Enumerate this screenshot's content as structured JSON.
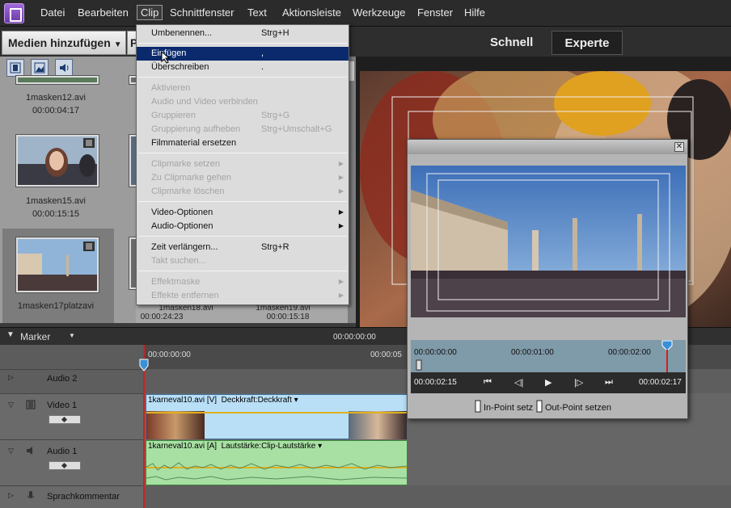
{
  "menubar": {
    "items": [
      "Datei",
      "Bearbeiten",
      "Clip",
      "Schnittfenster",
      "Text",
      "Aktionsleiste",
      "Werkzeuge",
      "Fenster",
      "Hilfe"
    ]
  },
  "toolbar": {
    "add_media": "Medien hinzufügen",
    "add_media_partial": "P",
    "mode_quick": "Schnell",
    "mode_expert": "Experte"
  },
  "media": {
    "cells": [
      {
        "name": "1masken12.avi",
        "time": "00:00:04:17"
      },
      {
        "name": "1masken15.avi",
        "time": "00:00:15:15"
      },
      {
        "name": "1masken17platzavi",
        "time": ""
      },
      {
        "name": "1masken18.avi",
        "time": "00:00:24:23"
      },
      {
        "name": "1masken19.avi",
        "time": "00:00:15:18"
      }
    ]
  },
  "clip_menu": {
    "items": [
      {
        "label": "Umbenennen...",
        "shortcut": "Strg+H",
        "enabled": true
      },
      {
        "label": "Einfügen",
        "shortcut": ",",
        "enabled": true,
        "highlighted": true
      },
      {
        "label": "Überschreiben",
        "shortcut": ".",
        "enabled": true
      },
      {
        "label": "Aktivieren",
        "shortcut": "",
        "enabled": false
      },
      {
        "label": "Audio und Video verbinden",
        "shortcut": "",
        "enabled": false
      },
      {
        "label": "Gruppieren",
        "shortcut": "Strg+G",
        "enabled": false
      },
      {
        "label": "Gruppierung aufheben",
        "shortcut": "Strg+Umschalt+G",
        "enabled": false
      },
      {
        "label": "Filmmaterial ersetzen",
        "shortcut": "",
        "enabled": true
      },
      {
        "label": "Clipmarke setzen",
        "shortcut": "",
        "enabled": false,
        "submenu": true
      },
      {
        "label": "Zu Clipmarke gehen",
        "shortcut": "",
        "enabled": false,
        "submenu": true
      },
      {
        "label": "Clipmarke löschen",
        "shortcut": "",
        "enabled": false,
        "submenu": true
      },
      {
        "label": "Video-Optionen",
        "shortcut": "",
        "enabled": true,
        "submenu": true
      },
      {
        "label": "Audio-Optionen",
        "shortcut": "",
        "enabled": true,
        "submenu": true
      },
      {
        "label": "Zeit verlängern...",
        "shortcut": "Strg+R",
        "enabled": true
      },
      {
        "label": "Takt suchen...",
        "shortcut": "",
        "enabled": false
      },
      {
        "label": "Effektmaske",
        "shortcut": "",
        "enabled": false,
        "submenu": true
      },
      {
        "label": "Effekte entfernen",
        "shortcut": "",
        "enabled": false,
        "submenu": true
      }
    ]
  },
  "timeline": {
    "marker_label": "Marker",
    "marker_timecode": "00:00:00:00",
    "ruler_start": "00:00:00:00",
    "ruler_next": "00:00:05",
    "tracks": {
      "audio2": "Audio 2",
      "video1": "Video 1",
      "audio1": "Audio 1",
      "narration": "Sprachkommentar"
    },
    "video_clip_label": "1karneval10.avi [V]",
    "video_clip_effect": "Deckkraft:Deckkraft",
    "audio_clip_label": "1karneval10.avi [A]",
    "audio_clip_effect": "Lautstärke:Clip-Lautstärke"
  },
  "trim": {
    "tc_start": "00:00:00:00",
    "tc_mid": "00:00:01:00",
    "tc_end": "00:00:02:00",
    "current": "00:00:02:15",
    "duration": "00:00:02:17",
    "in_point": "In-Point setz",
    "out_point": "Out-Point setzen"
  }
}
